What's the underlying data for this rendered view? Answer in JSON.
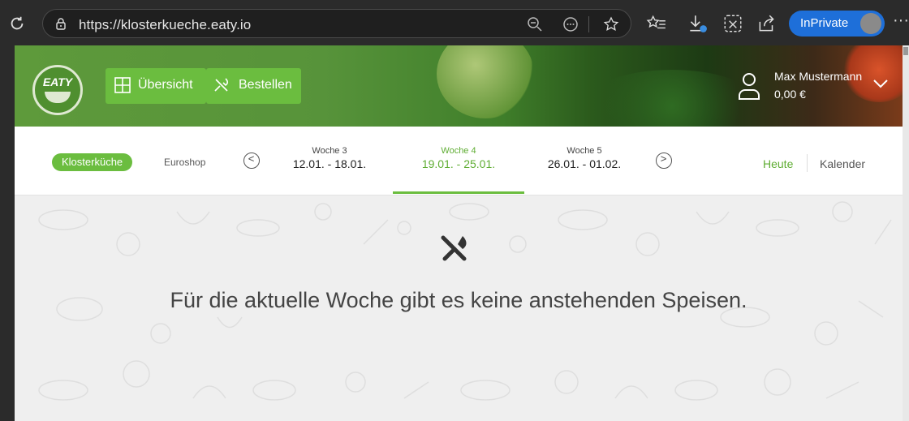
{
  "browser": {
    "url": "https://klosterkueche.eaty.io",
    "inprivate_label": "InPrivate",
    "more": "···"
  },
  "header": {
    "logo_text": "EATY",
    "nav": [
      {
        "label": "Übersicht",
        "icon": "grid-icon"
      },
      {
        "label": "Bestellen",
        "icon": "cutlery-icon"
      }
    ],
    "user": {
      "name": "Max Mustermann",
      "balance": "0,00 €"
    }
  },
  "weekbar": {
    "shop_active": "Klosterküche",
    "shop_other": "Euroshop",
    "weeks": [
      {
        "name": "Woche 3",
        "dates": "12.01. - 18.01."
      },
      {
        "name": "Woche 4",
        "dates": "19.01. - 25.01."
      },
      {
        "name": "Woche 5",
        "dates": "26.01. - 01.02."
      }
    ],
    "active_week_index": 1,
    "prev": "<",
    "next": ">",
    "today": "Heute",
    "calendar": "Kalender"
  },
  "content": {
    "message": "Für die aktuelle Woche gibt es keine anstehenden Speisen."
  },
  "colors": {
    "accent": "#6bbd3f",
    "accent_text": "#5fad33",
    "inprivate": "#1e6fd9"
  }
}
